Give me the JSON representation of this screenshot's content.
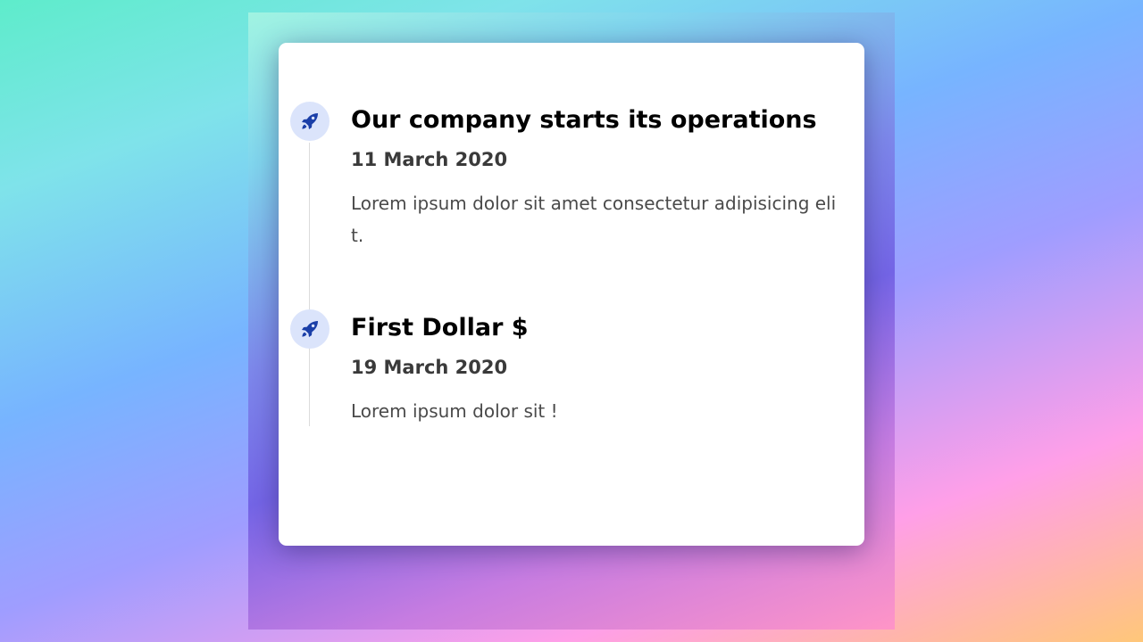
{
  "colors": {
    "card_background": "#ffffff",
    "marker_background": "#dbe4fb",
    "rocket_icon": "#1b3fa8",
    "title_text": "#000000",
    "date_text": "#3a3a3a",
    "body_text": "#4a4a4a",
    "timeline_line": "#dcdcdc"
  },
  "timeline": {
    "events": [
      {
        "icon": "rocket-icon",
        "title": "Our company starts its operations",
        "date": "11 March 2020",
        "description": "Lorem ipsum dolor sit amet consectetur adipisicing elit."
      },
      {
        "icon": "rocket-icon",
        "title": "First Dollar $",
        "date": "19 March 2020",
        "description": "Lorem ipsum dolor sit !"
      }
    ]
  }
}
